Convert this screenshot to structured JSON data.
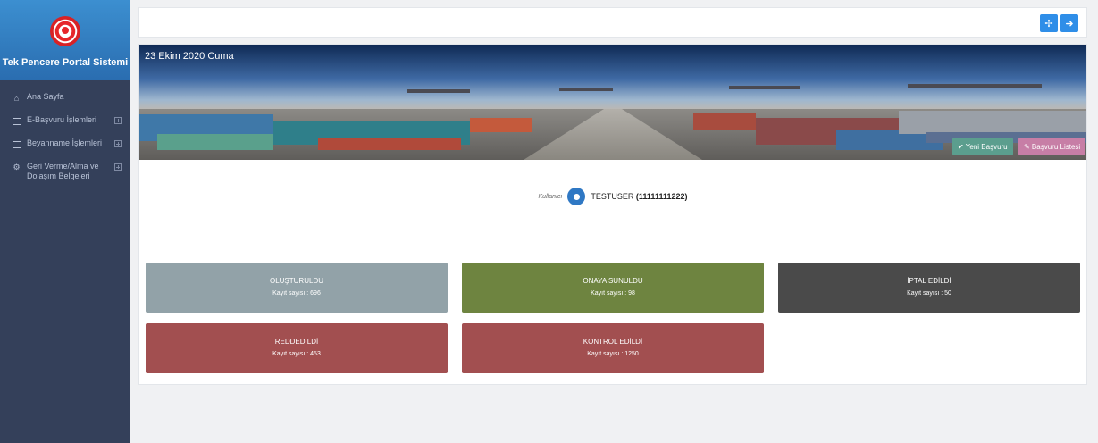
{
  "sidebar": {
    "brand_title": "Tek Pencere Portal Sistemi",
    "items": [
      {
        "label": "Ana Sayfa",
        "icon": "home-icon"
      },
      {
        "label": "E-Başvuru İşlemleri",
        "icon": "chart-icon"
      },
      {
        "label": "Beyanname İşlemleri",
        "icon": "image-icon"
      },
      {
        "label": "Geri Verme/Alma ve Dolaşım Belgeleri",
        "icon": "gear-icon"
      }
    ]
  },
  "topbar": {
    "fullscreen_icon": "expand-icon",
    "logout_icon": "sign-out-icon"
  },
  "banner": {
    "date": "23 Ekim 2020 Cuma",
    "new_application": "✔ Yeni Başvuru",
    "application_list": "✎ Başvuru Listesi"
  },
  "user": {
    "caption": "Kullanıcı",
    "name": "TESTUSER",
    "id": "(11111111222)"
  },
  "cards": [
    {
      "title": "OLUŞTURULDU",
      "count": "Kayıt sayısı : 696"
    },
    {
      "title": "ONAYA SUNULDU",
      "count": "Kayıt sayısı : 98"
    },
    {
      "title": "İPTAL EDİLDİ",
      "count": "Kayıt sayısı : 50"
    },
    {
      "title": "REDDEDİLDİ",
      "count": "Kayıt sayısı : 453"
    },
    {
      "title": "KONTROL EDİLDİ",
      "count": "Kayıt sayısı : 1250"
    }
  ],
  "colors": {
    "sidebar_bg": "#34405a",
    "brand_bg": "#2a6db0",
    "accent_blue": "#2f8ee8",
    "olusturuldu": "#92a2a8",
    "onaya_sunuldu": "#6e8440",
    "iptal_edildi": "#4a4a4a",
    "reddedildi": "#a24f50",
    "kontrol_edildi": "#a24f50"
  }
}
